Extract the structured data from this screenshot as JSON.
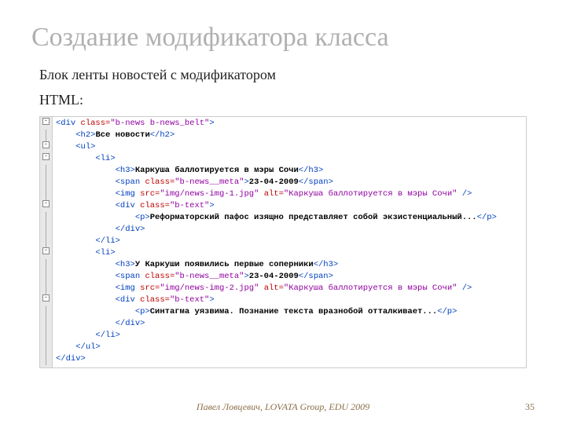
{
  "slide": {
    "title": "Создание модификатора класса",
    "subtitle_l1": "Блок ленты новостей с модификатором",
    "subtitle_l2": "HTML:"
  },
  "gutter": [
    {
      "kind": "box",
      "sym": "-"
    },
    {
      "kind": "line"
    },
    {
      "kind": "box",
      "sym": "-"
    },
    {
      "kind": "box",
      "sym": "-"
    },
    {
      "kind": "line"
    },
    {
      "kind": "line"
    },
    {
      "kind": "line"
    },
    {
      "kind": "box",
      "sym": "-"
    },
    {
      "kind": "line"
    },
    {
      "kind": "line"
    },
    {
      "kind": "line"
    },
    {
      "kind": "box",
      "sym": "-"
    },
    {
      "kind": "line"
    },
    {
      "kind": "line"
    },
    {
      "kind": "line"
    },
    {
      "kind": "box",
      "sym": "-"
    },
    {
      "kind": "line"
    },
    {
      "kind": "line"
    },
    {
      "kind": "line"
    },
    {
      "kind": "line"
    },
    {
      "kind": "line"
    }
  ],
  "code": [
    {
      "indent": 0,
      "parts": [
        {
          "c": "brk",
          "t": "<div "
        },
        {
          "c": "attr",
          "t": "class="
        },
        {
          "c": "str",
          "t": "\"b-news b-news_belt\""
        },
        {
          "c": "brk",
          "t": ">"
        }
      ]
    },
    {
      "indent": 1,
      "parts": [
        {
          "c": "brk",
          "t": "<h2>"
        },
        {
          "c": "txt",
          "t": "Все новости"
        },
        {
          "c": "brk",
          "t": "</h2>"
        }
      ]
    },
    {
      "indent": 1,
      "parts": [
        {
          "c": "brk",
          "t": "<ul>"
        }
      ]
    },
    {
      "indent": 2,
      "parts": [
        {
          "c": "brk",
          "t": "<li>"
        }
      ]
    },
    {
      "indent": 3,
      "parts": [
        {
          "c": "brk",
          "t": "<h3>"
        },
        {
          "c": "txt",
          "t": "Каркуша баллотируется в мэры Сочи"
        },
        {
          "c": "brk",
          "t": "</h3>"
        }
      ]
    },
    {
      "indent": 3,
      "parts": [
        {
          "c": "brk",
          "t": "<span "
        },
        {
          "c": "attr",
          "t": "class="
        },
        {
          "c": "str",
          "t": "\"b-news__meta\""
        },
        {
          "c": "brk",
          "t": ">"
        },
        {
          "c": "txt",
          "t": "23-04-2009"
        },
        {
          "c": "brk",
          "t": "</span>"
        }
      ]
    },
    {
      "indent": 3,
      "parts": [
        {
          "c": "brk",
          "t": "<img "
        },
        {
          "c": "attr",
          "t": "src="
        },
        {
          "c": "str",
          "t": "\"img/news-img-1.jpg\""
        },
        {
          "c": "attr",
          "t": " alt="
        },
        {
          "c": "str",
          "t": "\"Каркуша баллотируется в мэры Сочи\""
        },
        {
          "c": "brk",
          "t": " />"
        }
      ]
    },
    {
      "indent": 3,
      "parts": [
        {
          "c": "brk",
          "t": "<div "
        },
        {
          "c": "attr",
          "t": "class="
        },
        {
          "c": "str",
          "t": "\"b-text\""
        },
        {
          "c": "brk",
          "t": ">"
        }
      ]
    },
    {
      "indent": 4,
      "parts": [
        {
          "c": "brk",
          "t": "<p>"
        },
        {
          "c": "txt",
          "t": "Реформаторский пафос изящно представляет собой экзистенциальный..."
        },
        {
          "c": "brk",
          "t": "</p>"
        }
      ]
    },
    {
      "indent": 3,
      "parts": [
        {
          "c": "brk",
          "t": "</div>"
        }
      ]
    },
    {
      "indent": 2,
      "parts": [
        {
          "c": "brk",
          "t": "</li>"
        }
      ]
    },
    {
      "indent": 2,
      "parts": [
        {
          "c": "brk",
          "t": "<li>"
        }
      ]
    },
    {
      "indent": 3,
      "parts": [
        {
          "c": "brk",
          "t": "<h3>"
        },
        {
          "c": "txt",
          "t": "У Каркуши появились первые соперники"
        },
        {
          "c": "brk",
          "t": "</h3>"
        }
      ]
    },
    {
      "indent": 3,
      "parts": [
        {
          "c": "brk",
          "t": "<span "
        },
        {
          "c": "attr",
          "t": "class="
        },
        {
          "c": "str",
          "t": "\"b-news__meta\""
        },
        {
          "c": "brk",
          "t": ">"
        },
        {
          "c": "txt",
          "t": "23-04-2009"
        },
        {
          "c": "brk",
          "t": "</span>"
        }
      ]
    },
    {
      "indent": 3,
      "parts": [
        {
          "c": "brk",
          "t": "<img "
        },
        {
          "c": "attr",
          "t": "src="
        },
        {
          "c": "str",
          "t": "\"img/news-img-2.jpg\""
        },
        {
          "c": "attr",
          "t": " alt="
        },
        {
          "c": "str",
          "t": "\"Каркуша баллотируется в мэры Сочи\""
        },
        {
          "c": "brk",
          "t": " />"
        }
      ]
    },
    {
      "indent": 3,
      "parts": [
        {
          "c": "brk",
          "t": "<div "
        },
        {
          "c": "attr",
          "t": "class="
        },
        {
          "c": "str",
          "t": "\"b-text\""
        },
        {
          "c": "brk",
          "t": ">"
        }
      ]
    },
    {
      "indent": 4,
      "parts": [
        {
          "c": "brk",
          "t": "<p>"
        },
        {
          "c": "txt",
          "t": "Синтагма уязвима. Познание текста вразнобой отталкивает..."
        },
        {
          "c": "brk",
          "t": "</p>"
        }
      ]
    },
    {
      "indent": 3,
      "parts": [
        {
          "c": "brk",
          "t": "</div>"
        }
      ]
    },
    {
      "indent": 2,
      "parts": [
        {
          "c": "brk",
          "t": "</li>"
        }
      ]
    },
    {
      "indent": 1,
      "parts": [
        {
          "c": "brk",
          "t": "</ul>"
        }
      ]
    },
    {
      "indent": 0,
      "parts": [
        {
          "c": "brk",
          "t": "</div>"
        }
      ]
    }
  ],
  "footer": {
    "credit": "Павел Ловцевич, LOVATA Group, EDU 2009",
    "page": "35"
  }
}
